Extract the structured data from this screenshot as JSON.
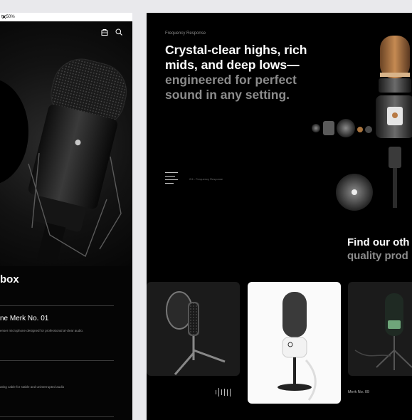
{
  "promo": {
    "text": "to 50%",
    "close": "✕"
  },
  "left": {
    "icons": [
      "bag-icon",
      "search-icon"
    ],
    "box_title": "box",
    "items": [
      {
        "title": "ne Merk No. 01",
        "desc": "enser microphone designed for professional al-clear audio."
      },
      {
        "title": "",
        "desc": "ating cable for stable and uninterrupted audio"
      }
    ]
  },
  "right": {
    "label": "Frequency Response",
    "headline_line1": "Crystal-clear highs, rich mids, and deep lows—",
    "headline_line2": "engineered for perfect sound in any setting.",
    "slide_indicator": "2/4 - Frequency Response",
    "find_line1": "Find our oth",
    "find_line2": "quality prod",
    "card_caption": "Merk No. 09"
  },
  "colors": {
    "accent_copper": "#b87a45",
    "panel_bg": "#000000",
    "page_bg": "#e9e9ec"
  }
}
